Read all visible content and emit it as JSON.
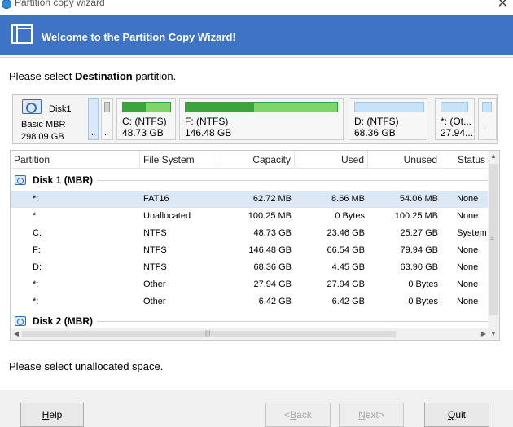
{
  "window": {
    "title": "Partition copy wizard",
    "close_glyph": "✕"
  },
  "banner": {
    "text": "Welcome to the Partition Copy Wizard!",
    "icon": "partition-copy-icon"
  },
  "prompt": {
    "prefix": "Please select ",
    "bold": "Destination",
    "suffix": " partition."
  },
  "disk_map": {
    "disk": {
      "name": "Disk1",
      "type": "Basic MBR",
      "size": "298.09 GB"
    },
    "partitions": [
      {
        "label": ".",
        "size": "."
      },
      {
        "label": ".",
        "size": "."
      },
      {
        "label": "C: (NTFS)",
        "size": "48.73 GB",
        "used_fraction": 0.48
      },
      {
        "label": "F: (NTFS)",
        "size": "146.48 GB",
        "used_fraction": 0.45
      },
      {
        "label": "D: (NTFS)",
        "size": "68.36 GB",
        "used_fraction": 0.07
      },
      {
        "label": "*: (Ot...",
        "size": "27.94..."
      },
      {
        "label": ".",
        "size": "."
      }
    ]
  },
  "table": {
    "columns": [
      "Partition",
      "File System",
      "Capacity",
      "Used",
      "Unused",
      "Status"
    ],
    "disks": [
      {
        "label": "Disk 1 (MBR)",
        "rows": [
          {
            "partition": "*:",
            "fs": "FAT16",
            "capacity": "62.72 MB",
            "used": "8.66 MB",
            "unused": "54.06 MB",
            "status": "None"
          },
          {
            "partition": "*",
            "fs": "Unallocated",
            "capacity": "100.25 MB",
            "used": "0 Bytes",
            "unused": "100.25 MB",
            "status": "None"
          },
          {
            "partition": "C:",
            "fs": "NTFS",
            "capacity": "48.73 GB",
            "used": "23.46 GB",
            "unused": "25.27 GB",
            "status": "System"
          },
          {
            "partition": "F:",
            "fs": "NTFS",
            "capacity": "146.48 GB",
            "used": "66.54 GB",
            "unused": "79.94 GB",
            "status": "None"
          },
          {
            "partition": "D:",
            "fs": "NTFS",
            "capacity": "68.36 GB",
            "used": "4.45 GB",
            "unused": "63.90 GB",
            "status": "None"
          },
          {
            "partition": "*:",
            "fs": "Other",
            "capacity": "27.94 GB",
            "used": "27.94 GB",
            "unused": "0 Bytes",
            "status": "None"
          },
          {
            "partition": "*:",
            "fs": "Other",
            "capacity": "6.42 GB",
            "used": "6.42 GB",
            "unused": "0 Bytes",
            "status": "None"
          }
        ]
      },
      {
        "label": "Disk 2 (MBR)",
        "rows": []
      }
    ]
  },
  "status_message": "Please select unallocated space.",
  "buttons": {
    "help": {
      "label": "Help",
      "mnemonic": "H",
      "rest": "elp"
    },
    "back": {
      "label": "<Back",
      "pre": "<",
      "mnemonic": "B",
      "rest": "ack"
    },
    "next": {
      "label": "Next>",
      "mnemonic": "N",
      "rest": "ext>"
    },
    "quit": {
      "label": "Quit",
      "mnemonic": "Q",
      "rest": "uit"
    }
  },
  "colors": {
    "banner": "#3f73c6",
    "selected_row": "#dde8f7",
    "used_bar": "#3aa53a",
    "free_bar_ntfs": "#7fd46a",
    "data_bar": "#c7e3fa"
  }
}
